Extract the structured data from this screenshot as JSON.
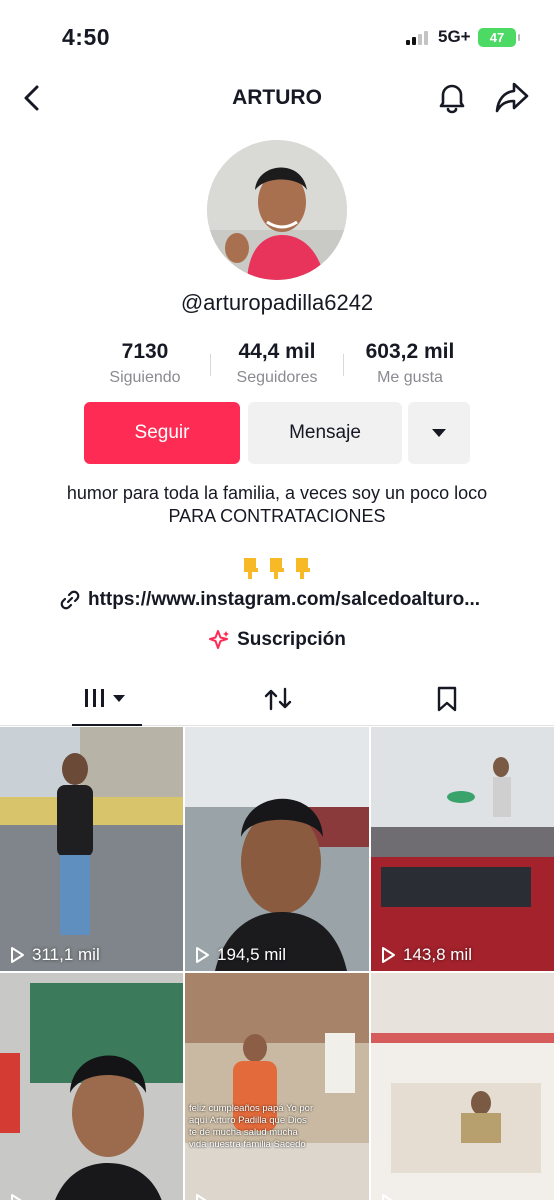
{
  "status_bar": {
    "time": "4:50",
    "network": "5G+",
    "battery": "47"
  },
  "header": {
    "title": "ARTURO"
  },
  "profile": {
    "handle": "@arturopadilla6242",
    "stats": [
      {
        "value": "7130",
        "label": "Siguiendo"
      },
      {
        "value": "44,4 mil",
        "label": "Seguidores"
      },
      {
        "value": "603,2 mil",
        "label": "Me gusta"
      }
    ],
    "follow_label": "Seguir",
    "message_label": "Mensaje",
    "bio_line1": "humor para toda la familia, a veces soy un poco loco",
    "bio_line2": "PARA CONTRATACIONES",
    "link": "https://www.instagram.com/salcedoalturo...",
    "subscription_label": "Suscripción"
  },
  "colors": {
    "accent": "#fe2c55",
    "secondary_button": "#f1f1f2",
    "muted_text": "#8a8b91"
  },
  "videos": [
    {
      "views": "311,1 mil"
    },
    {
      "views": "194,5 mil"
    },
    {
      "views": "143,8 mil"
    },
    {
      "views": ""
    },
    {
      "views": "",
      "caption": "feliz cumpleaños papá Yo por aquí Arturo Padilla que Dios te dé mucha salud mucha vida nuestra familia Sacedo"
    },
    {
      "views": ""
    }
  ]
}
